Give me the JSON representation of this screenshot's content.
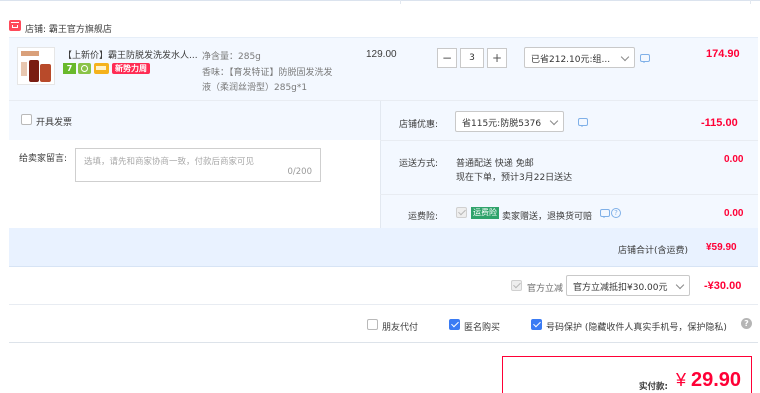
{
  "shop": {
    "label": "店铺: 霸王官方旗舰店"
  },
  "item": {
    "title": "【上新价】霸王防脱发洗发水人...",
    "badge_text": "新势力周",
    "spec_line1": "净含量：285g",
    "spec_line2": "香味：【育发特证】防脱固发洗发",
    "spec_line3": "液（柔润丝滑型）285g*1",
    "price": "129.00",
    "quantity": "3",
    "minus": "−",
    "plus": "+",
    "promo": "已省212.10元:组...",
    "subtotal": "174.90"
  },
  "order": {
    "open_invoice": "开具发票",
    "shop_discount_label": "店铺优惠:",
    "shop_discount_value": "省115元:防脱5376",
    "shop_discount_amount": "-115.00",
    "memo_label": "给卖家留言:",
    "memo_placeholder": "选填，请先和商家协商一致，付款后商家可见",
    "memo_counter": "0/200",
    "shipping_label": "运送方式:",
    "shipping_desc1": "普通配送 快递 免邮",
    "shipping_desc2": "现在下单，预计3月22日送达",
    "shipping_amount": "0.00",
    "insurance_label": "运费险:",
    "insurance_tag": "运费险",
    "insurance_desc": "卖家赠送，退换货可赔",
    "insurance_amount": "0.00",
    "total_label": "店铺合计(含运费)",
    "total_value": "¥59.90"
  },
  "platform": {
    "label": "官方立减",
    "select_value": "官方立减抵扣¥30.00元",
    "amount": "-¥30.00"
  },
  "options": {
    "friend_pay": "朋友代付",
    "anonymous": "匿名购买",
    "privacy": "号码保护 (隐藏收件人真实手机号，保护隐私)"
  },
  "summary": {
    "label": "实付款:",
    "currency": "¥",
    "amount": "29.90"
  },
  "colors": {
    "accent": "#ff0036",
    "blue_check": "#3a7bf4",
    "band": "#f0f7ff"
  }
}
